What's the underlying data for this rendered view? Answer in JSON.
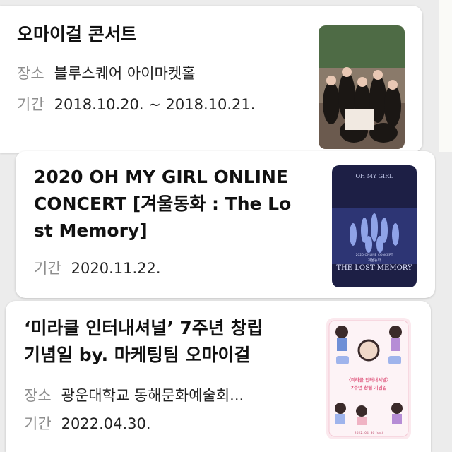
{
  "cards": [
    {
      "title": "오마이걸 콘서트",
      "rows": [
        {
          "label": "장소",
          "value": "블루스퀘어 아이마켓홀"
        },
        {
          "label": "기간",
          "value": "2018.10.20. ~ 2018.10.21."
        }
      ],
      "thumbnail": "concert-poster-group-photo"
    },
    {
      "title_lines": [
        "2020 OH MY GIRL ONLINE",
        "CONCERT [겨울동화 : The Lo",
        "st Memory]"
      ],
      "rows": [
        {
          "label": "기간",
          "value": "2020.11.22."
        }
      ],
      "thumbnail": "online-concert-poster",
      "poster_text": {
        "logo": "OH MY GIRL",
        "subtitle": "2020 ONLINE CONCERT",
        "kr": "겨울동화",
        "name": "THE LOST MEMORY"
      }
    },
    {
      "title_lines": [
        "‘미라클 인터내셔널’ 7주년 창립",
        "기념일 by. 마케팅팀 오마이걸"
      ],
      "rows": [
        {
          "label": "장소",
          "value": "광운대학교 동해문화예술회..."
        },
        {
          "label": "기간",
          "value": "2022.04.30."
        }
      ],
      "thumbnail": "anniversary-illustration-poster",
      "poster_text": {
        "line1": "〈미라클 인터내셔널〉",
        "line2": "7주년 창립 기념일",
        "date": "2022. 04. 30 (sat)"
      }
    }
  ],
  "colors": {
    "label": "#8e8e8e",
    "text": "#111111",
    "card": "#ffffff",
    "bg": "#ececec"
  }
}
